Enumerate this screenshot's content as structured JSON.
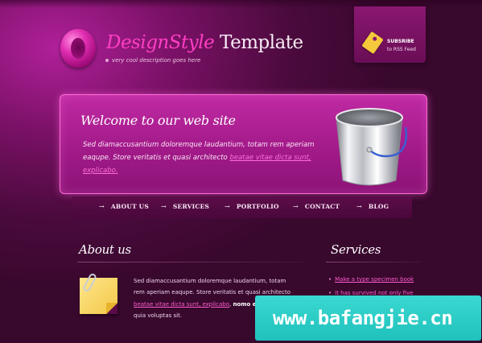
{
  "header": {
    "logo_letter": "O",
    "brand_part1": "DesignStyle",
    "brand_part2": "Template",
    "tagline": "very cool description goes here"
  },
  "rss": {
    "line1": "SUBSRIBE",
    "line2": "to RSS Feed",
    "icon": "tag-icon"
  },
  "hero": {
    "title": "Welcome to our web site",
    "text": "Sed diamaccusantium doloremque laudantium, totam rem aperiam eaqupe. Store veritatis et quasi architecto",
    "link_text": "beatae vitae dicta sunt, explicabo.",
    "image": "paint-bucket-icon"
  },
  "nav": {
    "items": [
      {
        "label": "ABOUT US"
      },
      {
        "label": "SERVICES"
      },
      {
        "label": "PORTFOLIO"
      },
      {
        "label": "CONTACT"
      },
      {
        "label": "BLOG"
      }
    ]
  },
  "about": {
    "title": "About us",
    "text_before": "Sed diamaccusantium doloremque laudantium, totam rem aperiam eaqupe. Store veritatis et quasi architecto",
    "link_text": "beatae vitae dicta sunt, explicabo",
    "bold_text": "nomo en",
    "text_after": "voluptatem, quia voluptas sit."
  },
  "services": {
    "title": "Services",
    "items": [
      {
        "label": "Make a type specimen book"
      },
      {
        "label": "It has survived not only five"
      }
    ]
  },
  "watermark": {
    "text": "www.bafangjie.cn"
  },
  "colors": {
    "accent": "#ff3fc4",
    "background": "#4a0a3c",
    "hero": "#a21a89",
    "watermark": "#2ecdc7"
  }
}
